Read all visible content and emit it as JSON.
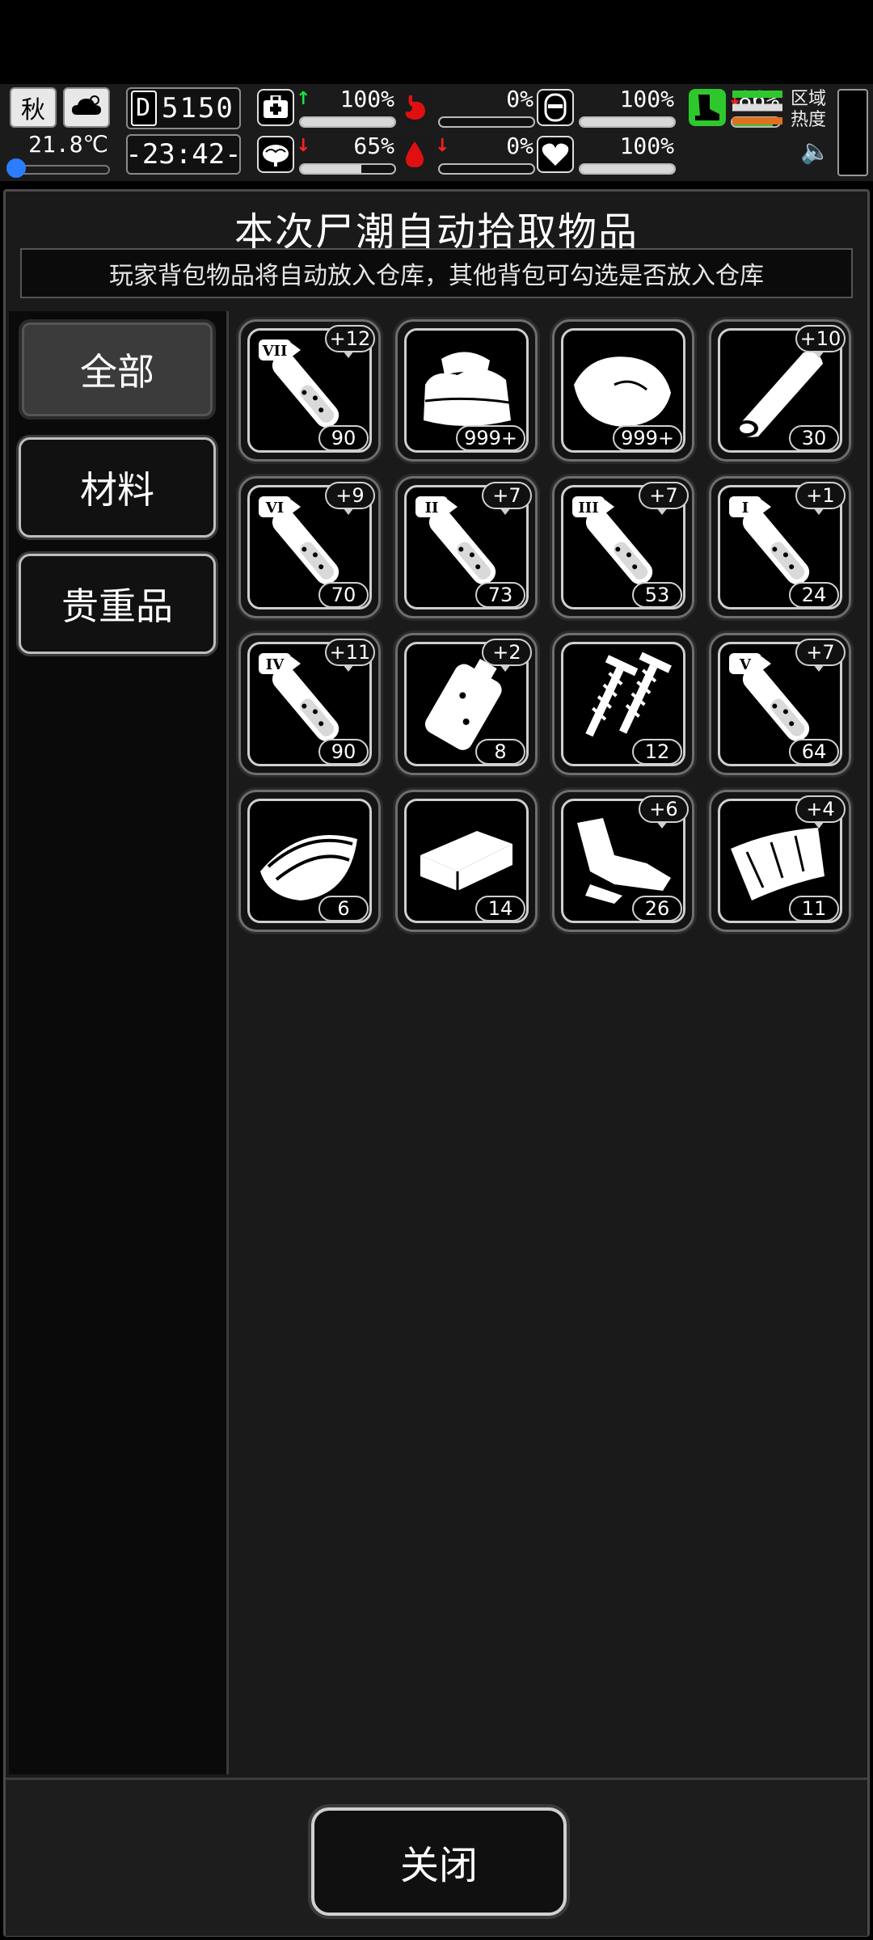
{
  "hud": {
    "season": "秋",
    "temperature": "21.8℃",
    "day_label": "D",
    "day": "5150",
    "time": "-23:42-",
    "stats": [
      {
        "name": "health",
        "icon": "medkit-icon",
        "arrow": "↑",
        "arrow_color": "#20e040",
        "value": "100%",
        "level": 1.0
      },
      {
        "name": "hunger",
        "icon": "stomach-icon",
        "arrow": "",
        "value": "0%",
        "level": 0.0
      },
      {
        "name": "armor",
        "icon": "helmet-icon",
        "arrow": "",
        "value": "100%",
        "level": 1.0
      },
      {
        "name": "brain",
        "icon": "brain-icon",
        "arrow": "↓",
        "arrow_color": "#ff2020",
        "value": "65%",
        "level": 0.65
      },
      {
        "name": "thirst",
        "icon": "water-drop-icon",
        "arrow": "↓",
        "arrow_color": "#ff2020",
        "value": "0%",
        "level": 0.0
      },
      {
        "name": "mood",
        "icon": "heart-icon",
        "arrow": "",
        "value": "100%",
        "level": 1.0
      },
      {
        "name": "stamina",
        "icon": "boot-icon",
        "arrow": "↓",
        "arrow_color": "#ff2020",
        "value": "86%",
        "level": 0.86
      }
    ],
    "region_label": "区域热度"
  },
  "panel": {
    "title": "本次尸潮自动拾取物品",
    "subtitle": "玩家背包物品将自动放入仓库，其他背包可勾选是否放入仓库"
  },
  "tabs": [
    {
      "label": "全部",
      "active": true
    },
    {
      "label": "材料",
      "active": false
    },
    {
      "label": "贵重品",
      "active": false
    }
  ],
  "items": [
    {
      "icon": "syringe-vii-icon",
      "roman": "VII",
      "bonus": "+12",
      "qty": "90"
    },
    {
      "icon": "cloth-icon",
      "roman": "",
      "bonus": "",
      "qty": "999+"
    },
    {
      "icon": "hide-leather-icon",
      "roman": "",
      "bonus": "",
      "qty": "999+"
    },
    {
      "icon": "wood-log-icon",
      "roman": "",
      "bonus": "+10",
      "qty": "30"
    },
    {
      "icon": "syringe-vi-icon",
      "roman": "VI",
      "bonus": "+9",
      "qty": "70"
    },
    {
      "icon": "syringe-ii-icon",
      "roman": "II",
      "bonus": "+7",
      "qty": "73"
    },
    {
      "icon": "syringe-iii-icon",
      "roman": "III",
      "bonus": "+7",
      "qty": "53"
    },
    {
      "icon": "syringe-i-icon",
      "roman": "I",
      "bonus": "+1",
      "qty": "24"
    },
    {
      "icon": "syringe-iv-icon",
      "roman": "IV",
      "bonus": "+11",
      "qty": "90"
    },
    {
      "icon": "pouch-icon",
      "roman": "",
      "bonus": "+2",
      "qty": "8"
    },
    {
      "icon": "screws-icon",
      "roman": "",
      "bonus": "",
      "qty": "12"
    },
    {
      "icon": "syringe-v-icon",
      "roman": "V",
      "bonus": "+7",
      "qty": "64"
    },
    {
      "icon": "bark-icon",
      "roman": "",
      "bonus": "",
      "qty": "6"
    },
    {
      "icon": "brick-icon",
      "roman": "",
      "bonus": "",
      "qty": "14"
    },
    {
      "icon": "scrap-metal-icon",
      "roman": "",
      "bonus": "+6",
      "qty": "26"
    },
    {
      "icon": "metal-sheet-icon",
      "roman": "",
      "bonus": "+4",
      "qty": "11"
    }
  ],
  "footer": {
    "close_label": "关闭"
  }
}
